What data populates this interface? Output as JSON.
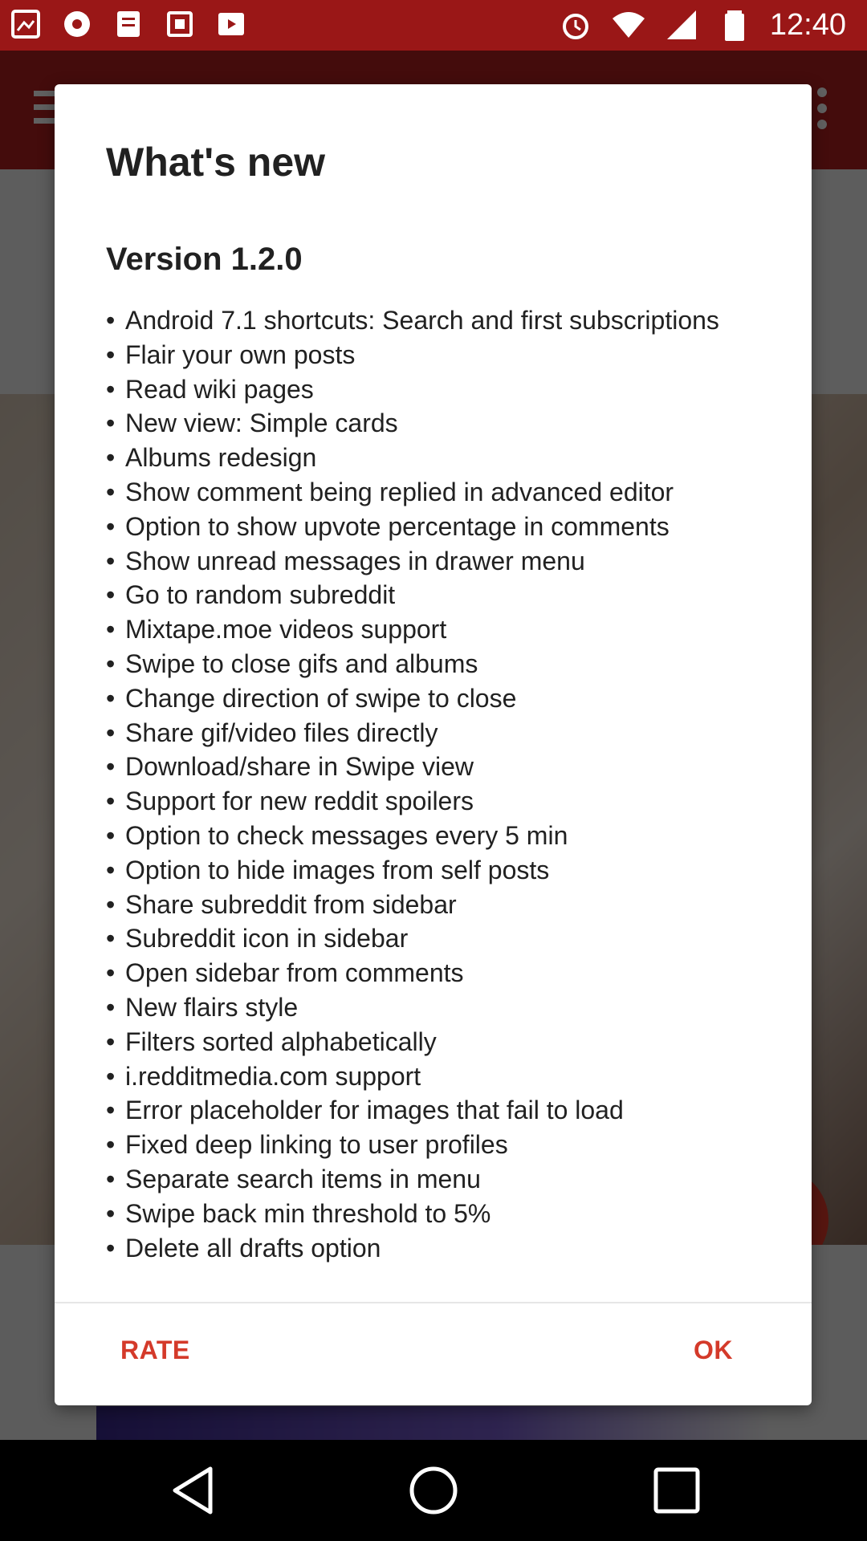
{
  "status_bar": {
    "time": "12:40",
    "left_icons": [
      "notification-icon",
      "notification-icon",
      "notification-icon",
      "notification-icon",
      "notification-icon"
    ],
    "right_icons": [
      "alarm-icon",
      "wifi-icon",
      "signal-icon",
      "battery-icon"
    ]
  },
  "dialog": {
    "title": "What's new",
    "version": "Version 1.2.0",
    "changes": [
      "Android 7.1 shortcuts: Search and first subscriptions",
      "Flair your own posts",
      "Read wiki pages",
      "New view: Simple cards",
      "Albums redesign",
      "Show comment being replied in advanced editor",
      "Option to show upvote percentage in comments",
      "Show unread messages in drawer menu",
      "Go to random subreddit",
      "Mixtape.moe videos support",
      "Swipe to close gifs and albums",
      "Change direction of swipe to close",
      "Share gif/video files directly",
      "Download/share in Swipe view",
      "Support for new reddit spoilers",
      "Option to check messages every 5 min",
      "Option to hide images from self posts",
      "Share subreddit from sidebar",
      "Subreddit icon in sidebar",
      "Open sidebar from comments",
      "New flairs style",
      "Filters sorted alphabetically",
      "i.redditmedia.com support",
      "Error placeholder for images that fail to load",
      "Fixed deep linking to user profiles",
      "Separate search items in menu",
      "Swipe back min threshold to 5%",
      "Delete all drafts option"
    ],
    "rate_label": "RATE",
    "ok_label": "OK"
  },
  "colors": {
    "accent": "#d43a2a",
    "status_bar": "#9a1717",
    "app_bar": "#b42020"
  }
}
